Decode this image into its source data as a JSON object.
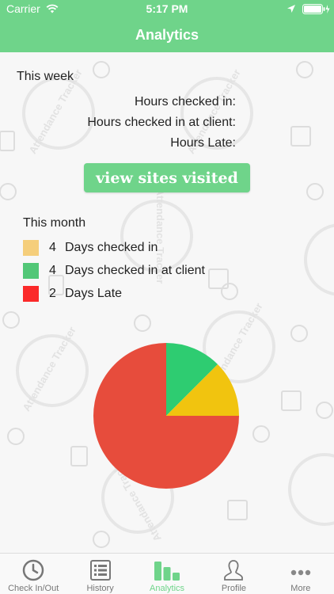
{
  "status_bar": {
    "carrier": "Carrier",
    "time": "5:17 PM"
  },
  "header": {
    "title": "Analytics"
  },
  "watermark_text": "Attendance Tracker",
  "week": {
    "title": "This week",
    "rows": [
      "Hours checked in:",
      "Hours checked in at client:",
      "Hours Late:"
    ]
  },
  "sites_button": {
    "label": "view sites visited"
  },
  "month": {
    "title": "This month",
    "legend": [
      {
        "count": "4",
        "label": "Days checked in",
        "color": "#f5ce7b"
      },
      {
        "count": "4",
        "label": "Days checked in at client",
        "color": "#52c777"
      },
      {
        "count": "2",
        "label": "Days Late",
        "color": "#fb2a2a"
      }
    ]
  },
  "chart_data": {
    "type": "pie",
    "title": "",
    "slices": [
      {
        "label": "",
        "value": 12.5,
        "color": "#2ecc71"
      },
      {
        "label": "",
        "value": 12.5,
        "color": "#f1c40f"
      },
      {
        "label": "",
        "value": 75,
        "color": "#e74c3c"
      }
    ]
  },
  "tabs": [
    {
      "label": "Check In/Out",
      "icon": "clock-icon",
      "active": false
    },
    {
      "label": "History",
      "icon": "list-icon",
      "active": false
    },
    {
      "label": "Analytics",
      "icon": "bar-chart-icon",
      "active": true
    },
    {
      "label": "Profile",
      "icon": "person-icon",
      "active": false
    },
    {
      "label": "More",
      "icon": "more-icon",
      "active": false
    }
  ],
  "colors": {
    "accent": "#6fd48a",
    "background": "#f7f7f7"
  }
}
